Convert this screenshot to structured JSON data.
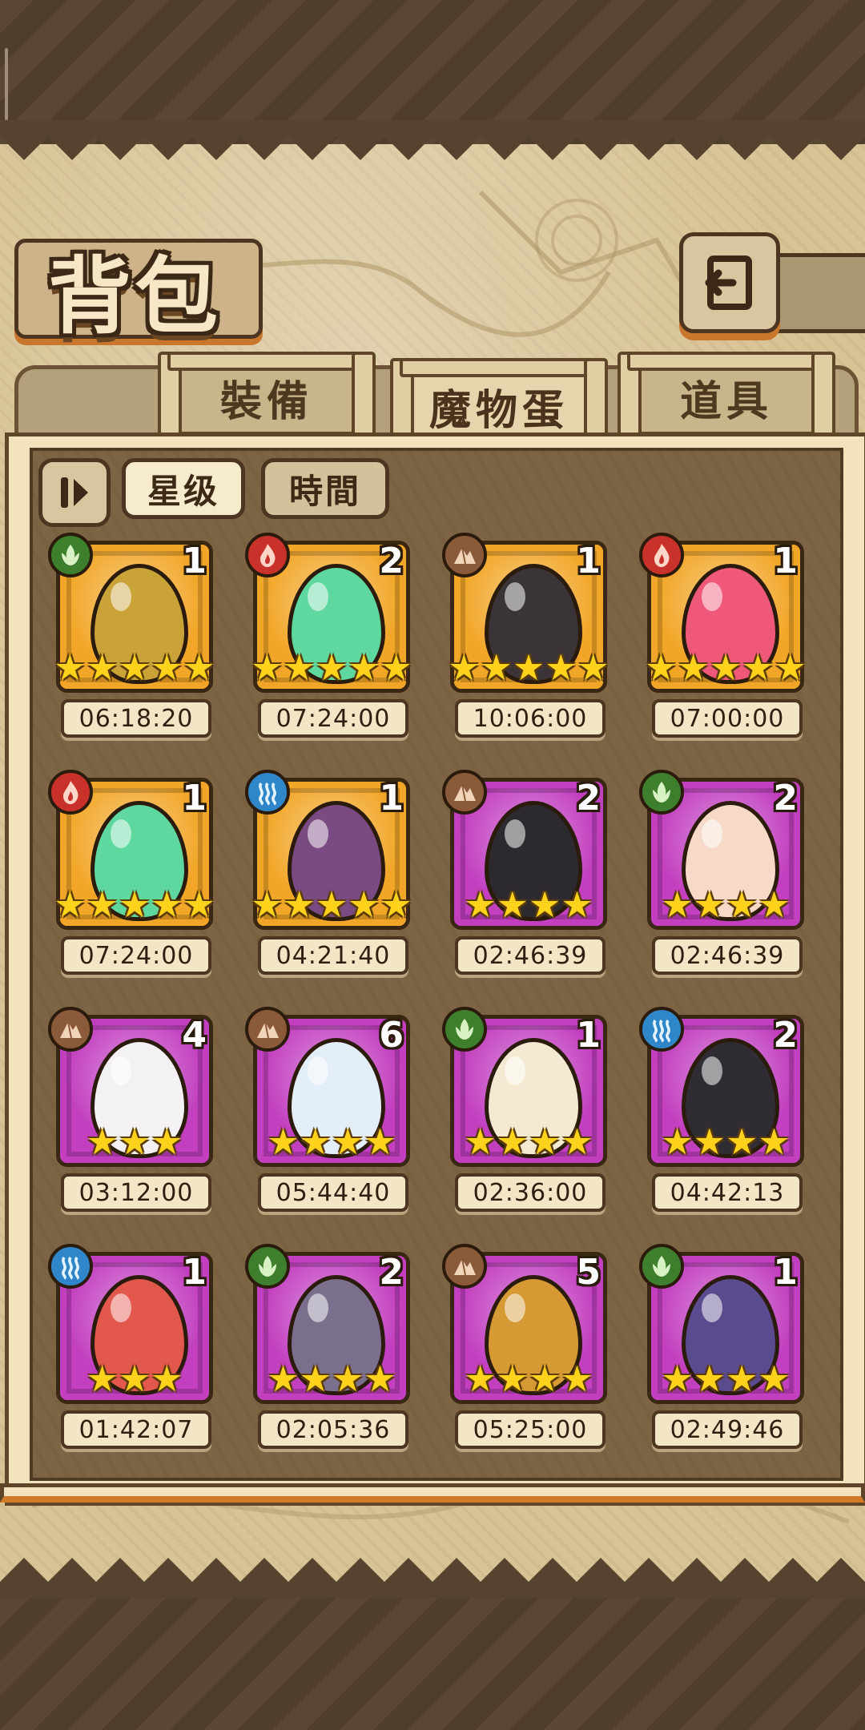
{
  "header": {
    "title": "背包",
    "back_label": ""
  },
  "tabs": [
    {
      "label": "裝備",
      "active": false
    },
    {
      "label": "魔物蛋",
      "active": true
    },
    {
      "label": "道具",
      "active": false
    }
  ],
  "sort": {
    "options": [
      "星级",
      "時間"
    ],
    "selected": "星级"
  },
  "colors": {
    "element": {
      "grass": "#3e7f2d",
      "fire": "#c8322a",
      "earth": "#8a5a3a",
      "water": "#2f86c9"
    },
    "rarity": {
      "gold": "#f2a627",
      "purple": "#c23fc0"
    }
  },
  "eggs": [
    {
      "element": "grass",
      "icon": "lamp-egg-icon",
      "count": "1",
      "stars": 5,
      "rarity": "gold",
      "timer": "06:18:20",
      "egg_color": "#c9a238"
    },
    {
      "element": "fire",
      "icon": "green-wing-egg-icon",
      "count": "2",
      "stars": 5,
      "rarity": "gold",
      "timer": "07:24:00",
      "egg_color": "#5fd8a0"
    },
    {
      "element": "earth",
      "icon": "coffin-egg-icon",
      "count": "1",
      "stars": 5,
      "rarity": "gold",
      "timer": "10:06:00",
      "egg_color": "#3a3438"
    },
    {
      "element": "fire",
      "icon": "pink-horn-egg-icon",
      "count": "1",
      "stars": 5,
      "rarity": "gold",
      "timer": "07:00:00",
      "egg_color": "#f0587a"
    },
    {
      "element": "fire",
      "icon": "green-wing-egg-icon",
      "count": "1",
      "stars": 5,
      "rarity": "gold",
      "timer": "07:24:00",
      "egg_color": "#5fd8a0"
    },
    {
      "element": "water",
      "icon": "crest-egg-icon",
      "count": "1",
      "stars": 5,
      "rarity": "gold",
      "timer": "04:21:40",
      "egg_color": "#7a4a82"
    },
    {
      "element": "earth",
      "icon": "spider-egg-icon",
      "count": "2",
      "stars": 4,
      "rarity": "purple",
      "timer": "02:46:39",
      "egg_color": "#2c2a2e"
    },
    {
      "element": "grass",
      "icon": "feather-nest-egg-icon",
      "count": "2",
      "stars": 4,
      "rarity": "purple",
      "timer": "02:46:39",
      "egg_color": "#f7d9c8"
    },
    {
      "element": "earth",
      "icon": "cracked-bow-egg-icon",
      "count": "4",
      "stars": 3,
      "rarity": "purple",
      "timer": "03:12:00",
      "egg_color": "#f4f1f5"
    },
    {
      "element": "earth",
      "icon": "crystal-egg-icon",
      "count": "6",
      "stars": 4,
      "rarity": "purple",
      "timer": "05:44:40",
      "egg_color": "#e4eef8"
    },
    {
      "element": "grass",
      "icon": "wing-white-egg-icon",
      "count": "1",
      "stars": 4,
      "rarity": "purple",
      "timer": "02:36:00",
      "egg_color": "#f4ead2"
    },
    {
      "element": "water",
      "icon": "spiked-black-egg-icon",
      "count": "2",
      "stars": 4,
      "rarity": "purple",
      "timer": "04:42:13",
      "egg_color": "#2f2d33"
    },
    {
      "element": "water",
      "icon": "rainbow-feather-egg-icon",
      "count": "1",
      "stars": 3,
      "rarity": "purple",
      "timer": "01:42:07",
      "egg_color": "#e2584c"
    },
    {
      "element": "grass",
      "icon": "studded-egg-icon",
      "count": "2",
      "stars": 4,
      "rarity": "purple",
      "timer": "02:05:36",
      "egg_color": "#7a6f8c"
    },
    {
      "element": "earth",
      "icon": "fur-gem-egg-icon",
      "count": "5",
      "stars": 4,
      "rarity": "purple",
      "timer": "05:25:00",
      "egg_color": "#d59a34"
    },
    {
      "element": "grass",
      "icon": "butterfly-egg-icon",
      "count": "1",
      "stars": 4,
      "rarity": "purple",
      "timer": "02:49:46",
      "egg_color": "#5a4a8e"
    }
  ]
}
